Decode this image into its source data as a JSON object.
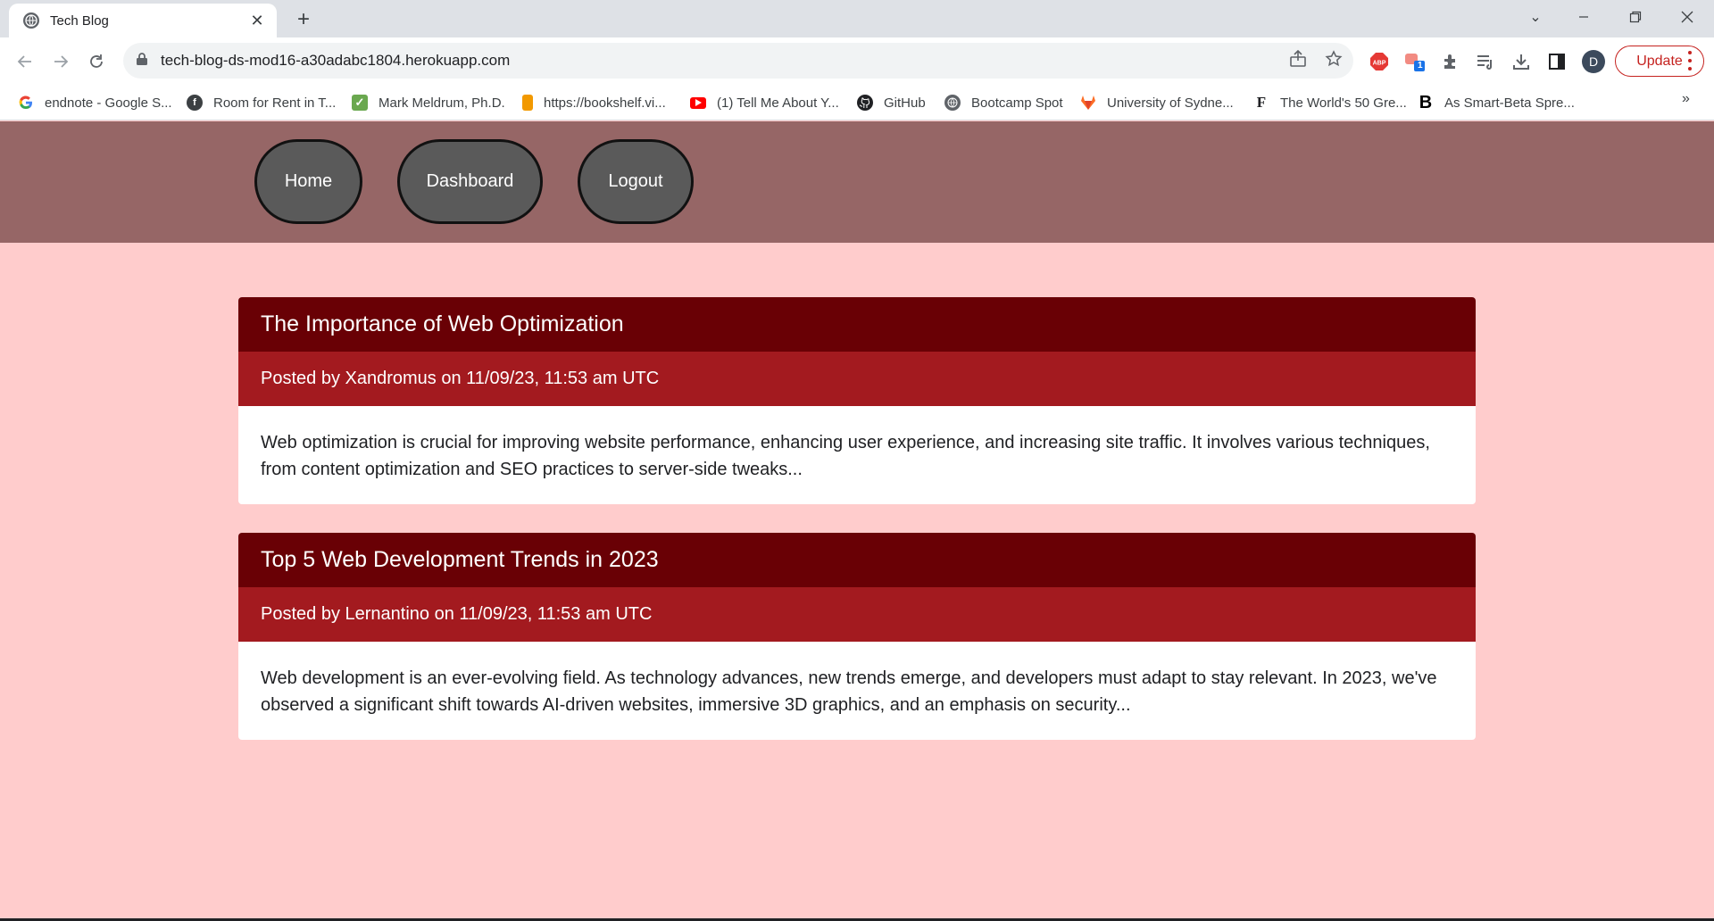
{
  "browser": {
    "tab_title": "Tech Blog",
    "url": "tech-blog-ds-mod16-a30adabc1804.herokuapp.com",
    "update_label": "Update",
    "profile_initial": "D",
    "extension_badge": "1",
    "icons": [
      "back-icon",
      "forward-icon",
      "reload-icon",
      "lock-icon",
      "share-icon",
      "star-icon",
      "abp-icon",
      "extensions-icon",
      "reading-list-icon",
      "download-icon",
      "side-panel-icon"
    ],
    "bookmarks": [
      {
        "label": "endnote - Google S...",
        "icon": "google-icon"
      },
      {
        "label": "Room for Rent in T...",
        "icon": "flatmates-icon"
      },
      {
        "label": "Mark Meldrum, Ph.D.",
        "icon": "checkmark-icon"
      },
      {
        "label": "https://bookshelf.vi...",
        "icon": "bookshelf-icon"
      },
      {
        "label": "(1) Tell Me About Y...",
        "icon": "youtube-icon"
      },
      {
        "label": "GitHub",
        "icon": "github-icon"
      },
      {
        "label": "Bootcamp Spot",
        "icon": "globe-icon"
      },
      {
        "label": "University of Sydne...",
        "icon": "gitlab-icon"
      },
      {
        "label": "The World's 50 Gre...",
        "icon": "fortune-icon"
      },
      {
        "label": "As Smart-Beta Spre...",
        "icon": "bloomberg-icon"
      }
    ],
    "bookmarks_more": "»"
  },
  "nav": {
    "home": "Home",
    "dashboard": "Dashboard",
    "logout": "Logout"
  },
  "posts": [
    {
      "title": "The Importance of Web Optimization",
      "meta": "Posted by Xandromus on 11/09/23, 11:53 am UTC",
      "body": "Web optimization is crucial for improving website performance, enhancing user experience, and increasing site traffic. It involves various techniques, from content optimization and SEO practices to server-side tweaks..."
    },
    {
      "title": "Top 5 Web Development Trends in 2023",
      "meta": "Posted by Lernantino on 11/09/23, 11:53 am UTC",
      "body": "Web development is an ever-evolving field. As technology advances, new trends emerge, and developers must adapt to stay relevant. In 2023, we've observed a significant shift towards AI-driven websites, immersive 3D graphics, and an emphasis on security..."
    }
  ],
  "colors": {
    "page_bg": "#ffcccc",
    "header_bg": "#966666",
    "nav_pill": "#5a5a5a",
    "post_title_bg": "#690005",
    "post_meta_bg": "#a31a1f"
  }
}
